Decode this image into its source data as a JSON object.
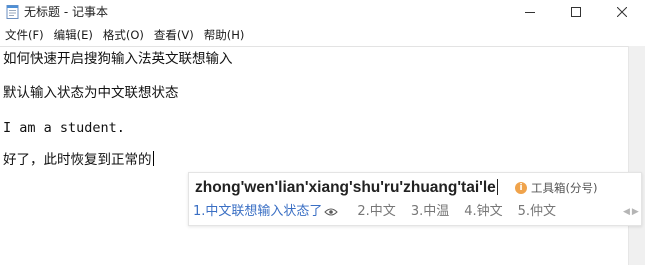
{
  "window": {
    "title": "无标题 - 记事本",
    "icon": "notepad-icon"
  },
  "controls": {
    "minimize": "minimize-icon",
    "maximize": "maximize-icon",
    "close": "close-icon"
  },
  "menu": {
    "items": [
      "文件(F)",
      "编辑(E)",
      "格式(O)",
      "查看(V)",
      "帮助(H)"
    ]
  },
  "editor": {
    "lines": [
      "如何快速开启搜狗输入法英文联想输入",
      "默认输入状态为中文联想状态",
      "I am a student.",
      "好了，此时恢复到正常的"
    ]
  },
  "ime": {
    "composition": "zhong'wen'lian'xiang'shu'ru'zhuang'tai'le",
    "toolbox_label": "工具箱(分号)",
    "toolbox_icon": "info-icon",
    "candidates": [
      "1.中文联想输入状态了",
      "2.中文",
      "3.中温",
      "4.钟文",
      "5.仲文"
    ],
    "accent_color": "#3a6fc4"
  }
}
